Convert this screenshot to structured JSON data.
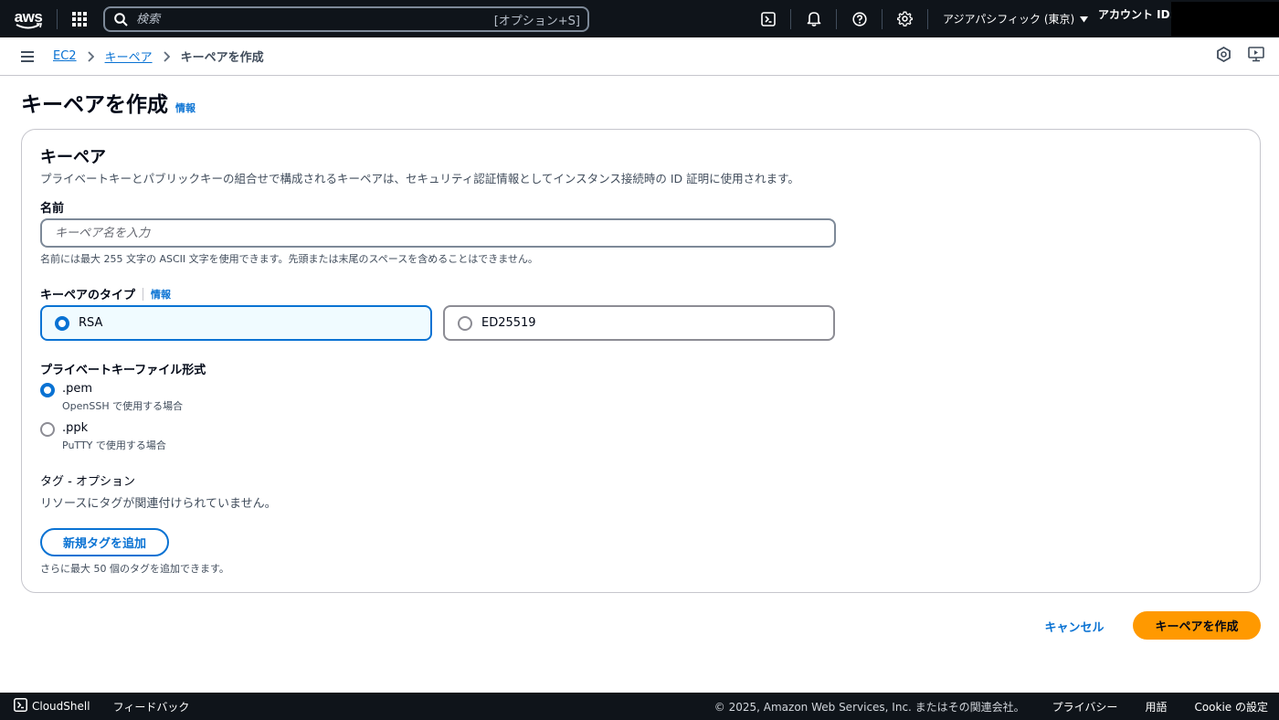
{
  "topnav": {
    "logo": "aws",
    "search_placeholder": "検索",
    "search_shortcut": "[オプション+S]",
    "region": "アジアパシフィック (東京)",
    "account_label": "アカウント ID:",
    "icons": [
      "cloudshell-icon",
      "bell-icon",
      "help-icon",
      "gear-icon"
    ]
  },
  "breadcrumb": {
    "items": [
      "EC2",
      "キーペア"
    ],
    "current": "キーペアを作成"
  },
  "page": {
    "title": "キーペアを作成",
    "info": "情報"
  },
  "form": {
    "title": "キーペア",
    "description": "プライベートキーとパブリックキーの組合せで構成されるキーペアは、セキュリティ認証情報としてインスタンス接続時の ID 証明に使用されます。",
    "name_label": "名前",
    "name_value": "",
    "name_placeholder": "キーペア名を入力",
    "name_hint": "名前には最大 255 文字の ASCII 文字を使用できます。先頭または末尾のスペースを含めることはできません。",
    "type_label": "キーペアのタイプ",
    "type_info": "情報",
    "types": [
      {
        "label": "RSA",
        "selected": true
      },
      {
        "label": "ED25519",
        "selected": false
      }
    ],
    "format_label": "プライベートキーファイル形式",
    "formats": [
      {
        "label": ".pem",
        "desc": "OpenSSH で使用する場合",
        "selected": true
      },
      {
        "label": ".ppk",
        "desc": "PuTTY で使用する場合",
        "selected": false
      }
    ],
    "tags_title": "タグ - オプション",
    "tags_empty": "リソースにタグが関連付けられていません。",
    "add_tag_label": "新規タグを追加",
    "tags_limit": "さらに最大 50 個のタグを追加できます。"
  },
  "actions": {
    "cancel": "キャンセル",
    "create": "キーペアを作成"
  },
  "footer": {
    "cloudshell": "CloudShell",
    "feedback": "フィードバック",
    "copyright": "© 2025, Amazon Web Services, Inc. またはその関連会社。",
    "privacy": "プライバシー",
    "terms": "用語",
    "cookie": "Cookie の設定"
  },
  "colors": {
    "primary": "#0972d3",
    "nav_bg": "#0f141a",
    "create_button": "#ff9900",
    "selected_card_bg": "#f0fbff"
  }
}
